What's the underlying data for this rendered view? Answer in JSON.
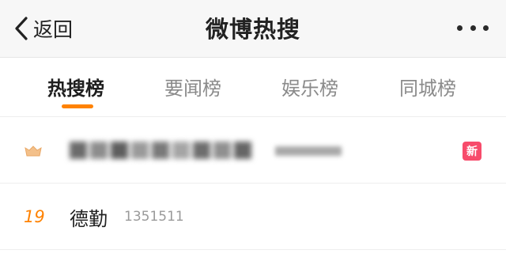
{
  "header": {
    "back_label": "返回",
    "title": "微博热搜"
  },
  "tabs": [
    {
      "label": "热搜榜",
      "active": true
    },
    {
      "label": "要闻榜",
      "active": false
    },
    {
      "label": "娱乐榜",
      "active": false
    },
    {
      "label": "同城榜",
      "active": false
    }
  ],
  "colors": {
    "accent": "#ff8200",
    "new_badge": "#f74b6b"
  },
  "hot_list": [
    {
      "rank_icon": "top-rank-icon",
      "title_redacted": true,
      "count_redacted": true,
      "badge": "新"
    },
    {
      "rank": "19",
      "title": "德勤",
      "count": "1351511"
    }
  ]
}
